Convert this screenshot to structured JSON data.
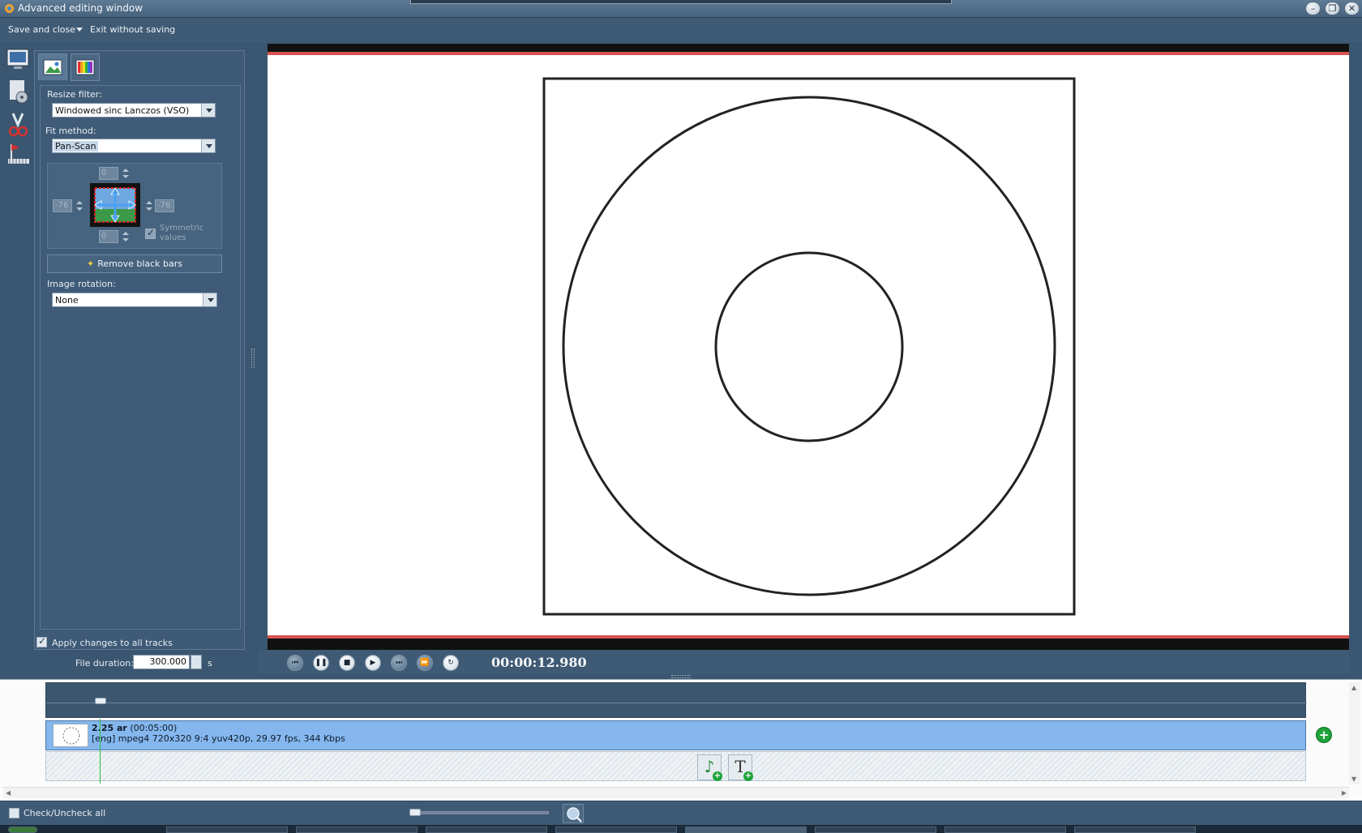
{
  "window": {
    "title": "Advanced editing window",
    "minimize": "–",
    "maximize": "❐",
    "close": "✕"
  },
  "menu": {
    "save_and_close": "Save and close",
    "exit_without_saving": "Exit without saving"
  },
  "panel": {
    "resize_filter_label": "Resize filter:",
    "resize_filter_value": "Windowed sinc Lanczos (VSO)",
    "fit_method_label": "Fit method:",
    "fit_method_value": "Pan-Scan",
    "crop": {
      "top": "0",
      "bottom": "0",
      "left": "-76",
      "right": "-76"
    },
    "symmetric_values": "Symmetric values",
    "remove_black_bars": "Remove black bars",
    "image_rotation_label": "Image rotation:",
    "image_rotation_value": "None",
    "apply_all_tracks": "Apply changes to all tracks",
    "file_duration_label": "File duration:",
    "file_duration_value": "300.000",
    "file_duration_unit": "s"
  },
  "playback": {
    "timecode": "00:00:12.980"
  },
  "timeline": {
    "clip_title": "2.25 ar",
    "clip_duration": " (00:05:00)",
    "clip_info": "[eng] mpeg4 720x320 9:4 yuv420p, 29.97 fps, 344 Kbps",
    "add_text_glyph": "T",
    "add_audio_glyph": "♪",
    "plus": "+"
  },
  "status": {
    "check_uncheck_all": "Check/Uncheck all"
  },
  "colors": {
    "panel_bg": "#3e5a76",
    "clip_bg": "#85b7ee",
    "letterbox_red": "#d8524f",
    "cursor_green": "#2bbf3c"
  },
  "icons": {
    "preview_tool": "monitor-icon",
    "audio_tool": "disc-icon",
    "cut_tool": "scissors-icon",
    "chapters_tool": "flag-icon",
    "image_tab": "image-icon",
    "color_tab": "color-bars-icon",
    "zoom": "magnifier-icon"
  }
}
